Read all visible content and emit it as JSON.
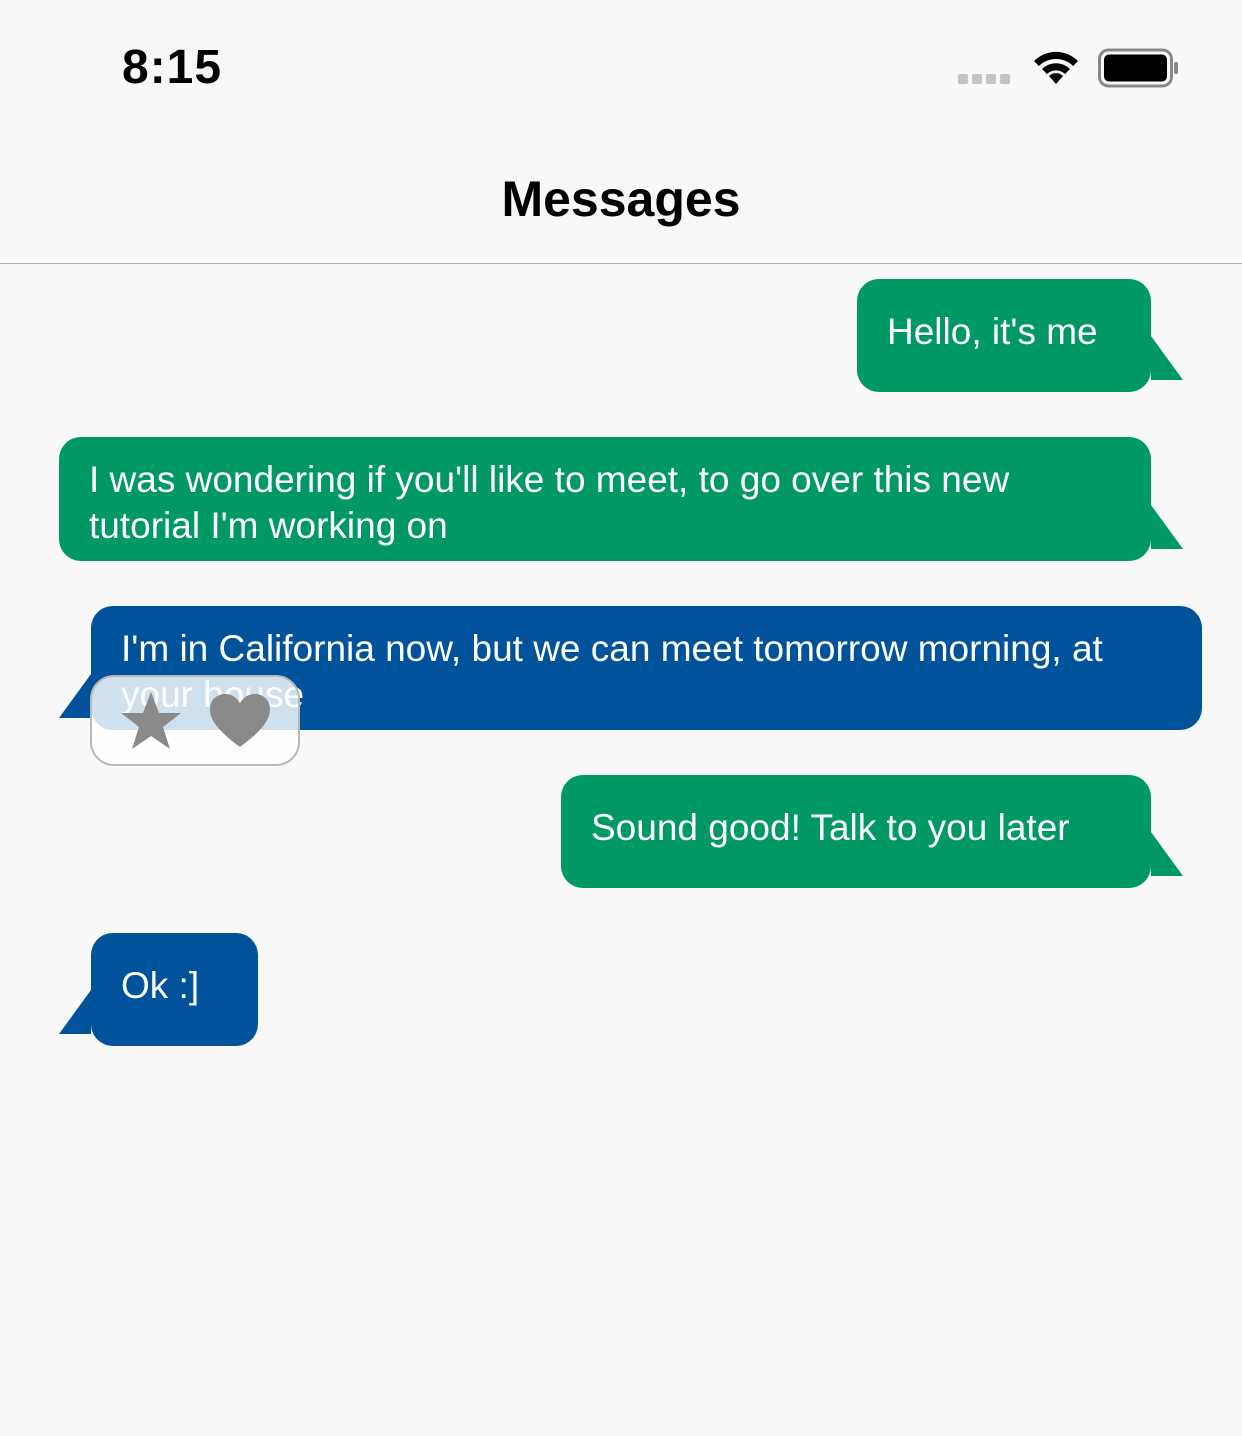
{
  "status_bar": {
    "time": "8:15",
    "icons": [
      "cellular-signal-icon",
      "wifi-icon",
      "battery-icon"
    ]
  },
  "nav": {
    "title": "Messages"
  },
  "messages": [
    {
      "direction": "outgoing",
      "text": "Hello, it's me"
    },
    {
      "direction": "outgoing",
      "text": "I was wondering if you'll like to meet, to go over this new tutorial I'm working on"
    },
    {
      "direction": "incoming",
      "text": "I'm in California now, but we can meet tomorrow morning, at your house"
    },
    {
      "direction": "outgoing",
      "text": "Sound good! Talk to you later"
    },
    {
      "direction": "incoming",
      "text": "Ok :]"
    }
  ],
  "reaction_picker": {
    "icons": [
      "star-icon",
      "heart-icon"
    ]
  },
  "colors": {
    "outgoing_bubble": "#009966",
    "incoming_bubble": "#00529a",
    "background": "#f8f8f8",
    "reaction_icon": "#8a8a8a"
  }
}
